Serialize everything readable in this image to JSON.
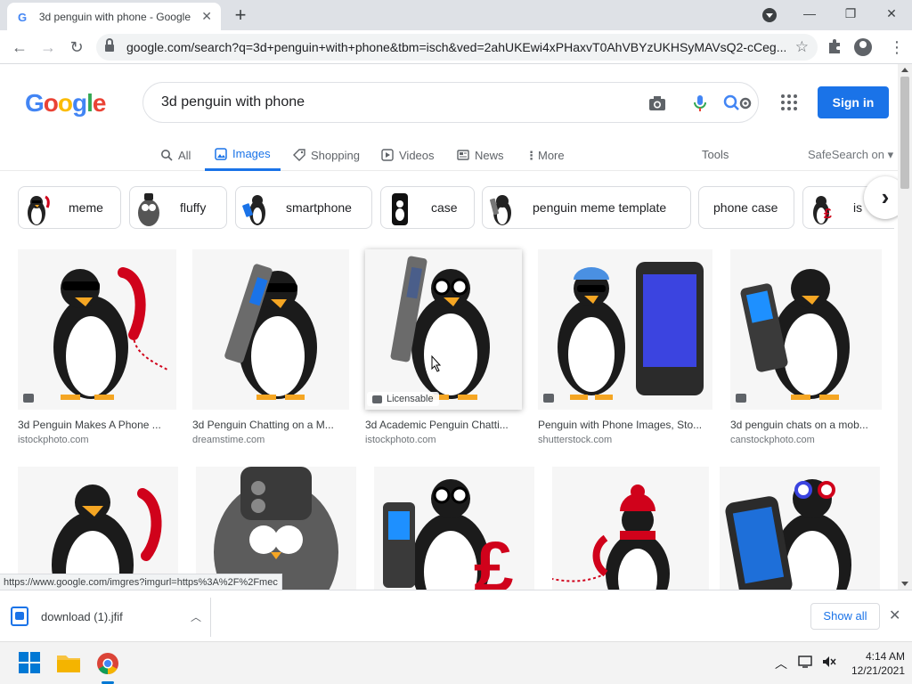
{
  "browser": {
    "tab_title": "3d penguin with phone - Google",
    "url": "google.com/search?q=3d+penguin+with+phone&tbm=isch&ved=2ahUKEwi4xPHaxvT0AhVBYzUKHSyMAVsQ2-cCeg...",
    "status_url": "https://www.google.com/imgres?imgurl=https%3A%2F%2Fmec"
  },
  "google": {
    "logo_letters": [
      "G",
      "o",
      "o",
      "g",
      "l",
      "e"
    ],
    "query": "3d penguin with phone",
    "signin_label": "Sign in",
    "tabs": [
      {
        "label": "All",
        "icon": "search-icon"
      },
      {
        "label": "Images",
        "icon": "image-icon"
      },
      {
        "label": "Shopping",
        "icon": "tag-icon"
      },
      {
        "label": "Videos",
        "icon": "play-icon"
      },
      {
        "label": "News",
        "icon": "news-icon"
      },
      {
        "label": "More",
        "icon": "more-vert-icon"
      }
    ],
    "tools_label": "Tools",
    "safesearch_label": "SafeSearch on ▾",
    "chips": [
      {
        "label": "meme"
      },
      {
        "label": "fluffy"
      },
      {
        "label": "smartphone"
      },
      {
        "label": "case"
      },
      {
        "label": "penguin meme template"
      },
      {
        "label": "phone case"
      },
      {
        "label": "is"
      }
    ],
    "results": [
      {
        "title": "3d Penguin Makes A Phone ...",
        "source": "istockphoto.com"
      },
      {
        "title": "3d Penguin Chatting on a M...",
        "source": "dreamstime.com"
      },
      {
        "title": "3d Academic Penguin Chatti...",
        "source": "istockphoto.com",
        "badge": "Licensable"
      },
      {
        "title": "Penguin with Phone Images, Sto...",
        "source": "shutterstock.com"
      },
      {
        "title": "3d penguin chats on a mob...",
        "source": "canstockphoto.com"
      }
    ]
  },
  "downloads": {
    "file_name": "download (1).jfif",
    "show_all_label": "Show all"
  },
  "taskbar": {
    "time": "4:14 AM",
    "date": "12/21/2021"
  },
  "colors": {
    "accent": "#1a73e8",
    "logo": [
      "#4285f4",
      "#ea4335",
      "#fbbc05",
      "#4285f4",
      "#34a853",
      "#ea4335"
    ]
  }
}
